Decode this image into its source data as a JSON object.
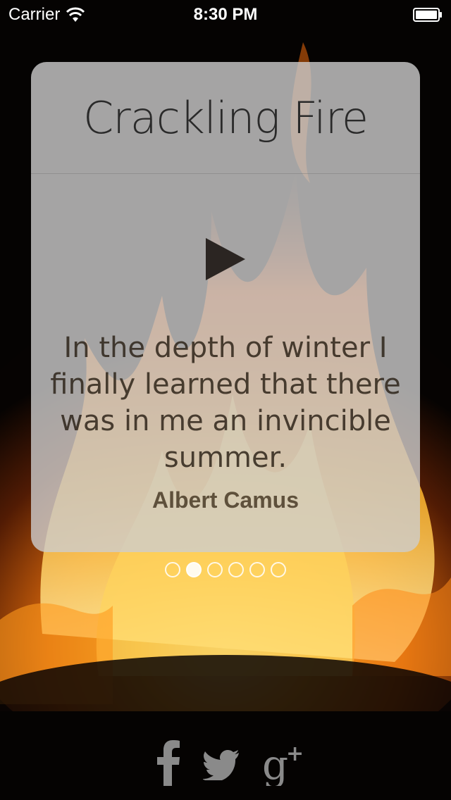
{
  "status_bar": {
    "carrier": "Carrier",
    "time": "8:30 PM"
  },
  "card": {
    "title": "Crackling Fire",
    "quote": "In the depth of winter I finally learned that there was in me an invincible summer.",
    "author": "Albert Camus"
  },
  "pager": {
    "count": 6,
    "active_index": 1
  },
  "social": {
    "icons": [
      "facebook-icon",
      "twitter-icon",
      "google-plus-icon"
    ]
  }
}
